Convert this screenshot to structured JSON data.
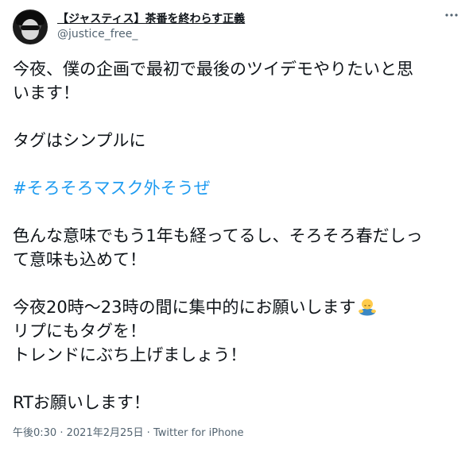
{
  "tweet": {
    "display_name": "【ジャスティス】茶番を終わらす正義",
    "handle": "@justice_free_",
    "more_icon": "more-horizontal-icon",
    "paragraphs": [
      [
        "今夜、僕の企画で最初で最後のツイデモやりたいと思",
        "います！"
      ],
      [
        "タグはシンプルに"
      ],
      [
        "#そろそろマスク外そうぜ"
      ],
      [
        "色んな意味でもう1年も経ってるし、そろそろ春だしっ",
        "て意味も込めて！"
      ],
      [
        "今夜20時〜23時の間に集中的にお願いします",
        "リプにもタグを！",
        "トレンドにぶち上げましょう！"
      ],
      [
        "RTお願いします！"
      ]
    ],
    "emoji": "person-bowing-emoji",
    "hashtag_color": "#1d9bf0",
    "time": "午後0:30",
    "separator": "·",
    "date": "2021年2月25日",
    "source": "Twitter for iPhone",
    "meta_color": "#536471"
  }
}
